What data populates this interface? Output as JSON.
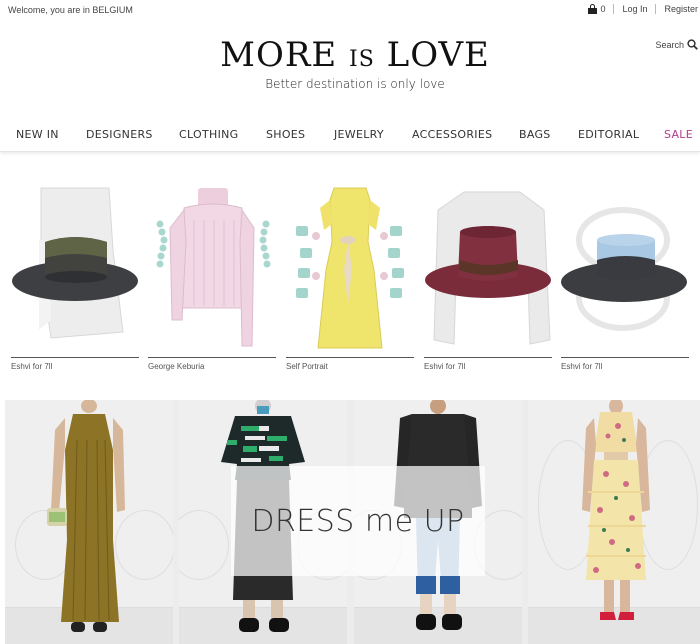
{
  "topbar": {
    "welcome": "Welcome, you are in BELGIUM",
    "cart_count": "0",
    "login": "Log In",
    "register": "Register"
  },
  "brand": {
    "title_part1": "MORE ",
    "title_part2": "IS",
    "title_part3": " LOVE",
    "tagline": "Better destination is only love"
  },
  "search": {
    "label": "Search"
  },
  "nav": {
    "items": [
      "NEW IN",
      "DESIGNERS",
      "CLOTHING",
      "SHOES",
      "JEWELRY",
      "ACCESSORIES",
      "BAGS",
      "EDITORIAL",
      "SALE"
    ],
    "sale_color": "#b43a8f"
  },
  "products": [
    {
      "label": "Eshvi for 7ll",
      "image": "grey-hat-over-skirt"
    },
    {
      "label": "George Keburia",
      "image": "pink-turtleneck-sweater"
    },
    {
      "label": "Self Portrait",
      "image": "yellow-lace-dress"
    },
    {
      "label": "Eshvi for 7ll",
      "image": "burgundy-hat-over-sweater"
    },
    {
      "label": "Eshvi for 7ll",
      "image": "blue-black-hat"
    }
  ],
  "banner": {
    "headline": "DRESS me UP",
    "looks": [
      "olive-pleated-dress",
      "striped-shirt-black-skirt",
      "black-jacket-jeans",
      "floral-ruffle-dress"
    ]
  },
  "colors": {
    "sale": "#b43a8f",
    "hat_grey": "#3e3f43",
    "hat_burgundy": "#7b2c3b",
    "hat_blue": "#a9c8e4"
  }
}
